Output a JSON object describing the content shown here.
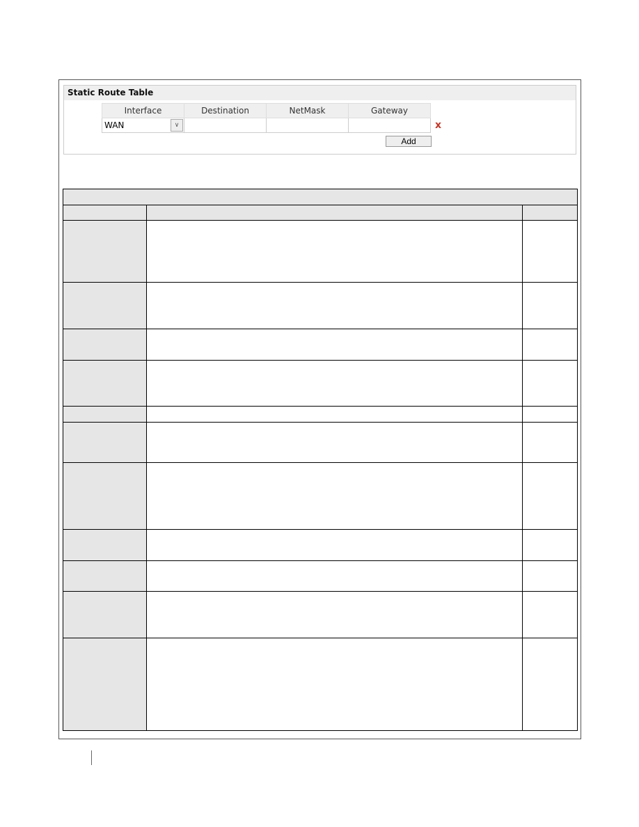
{
  "static_route": {
    "title": "Static Route Table",
    "columns": [
      "Interface",
      "Destination",
      "NetMask",
      "Gateway"
    ],
    "row": {
      "interface": "WAN",
      "destination": "",
      "netmask": "",
      "gateway": ""
    },
    "add_label": "Add",
    "delete_icon": "x"
  },
  "table": {
    "row_heights_note": "",
    "rows": 11
  }
}
